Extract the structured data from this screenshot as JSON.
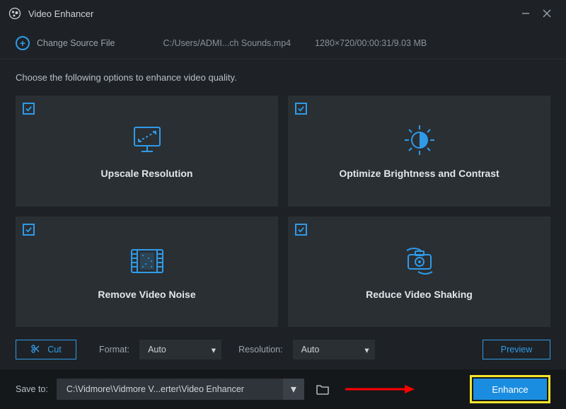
{
  "titlebar": {
    "title": "Video Enhancer"
  },
  "toolbar": {
    "change_label": "Change Source File",
    "filepath": "C:/Users/ADMI...ch Sounds.mp4",
    "meta": "1280×720/00:00:31/9.03 MB"
  },
  "content": {
    "instruction": "Choose the following options to enhance video quality.",
    "cards": [
      {
        "label": "Upscale Resolution"
      },
      {
        "label": "Optimize Brightness and Contrast"
      },
      {
        "label": "Remove Video Noise"
      },
      {
        "label": "Reduce Video Shaking"
      }
    ]
  },
  "controls": {
    "cut_label": "Cut",
    "format_label": "Format:",
    "format_value": "Auto",
    "resolution_label": "Resolution:",
    "resolution_value": "Auto",
    "preview_label": "Preview"
  },
  "footer": {
    "save_to_label": "Save to:",
    "save_path": "C:\\Vidmore\\Vidmore V...erter\\Video Enhancer",
    "enhance_label": "Enhance"
  }
}
